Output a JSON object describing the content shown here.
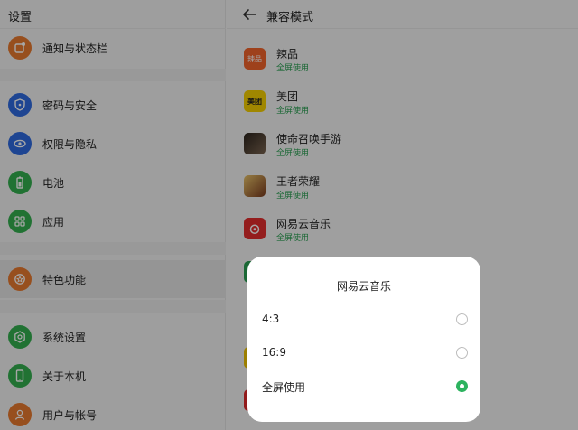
{
  "left": {
    "title": "设置",
    "items": [
      {
        "label": "通知与状态栏",
        "icon": "notification-icon",
        "color": "#e97a2e"
      },
      {
        "label": "密码与安全",
        "icon": "shield-icon",
        "color": "#2f6be0"
      },
      {
        "label": "权限与隐私",
        "icon": "eye-icon",
        "color": "#2f6be0"
      },
      {
        "label": "电池",
        "icon": "battery-icon",
        "color": "#33b04f"
      },
      {
        "label": "应用",
        "icon": "apps-grid-icon",
        "color": "#33b04f"
      },
      {
        "label": "特色功能",
        "icon": "star-icon",
        "color": "#e97a2e"
      },
      {
        "label": "系统设置",
        "icon": "system-settings-icon",
        "color": "#33b04f"
      },
      {
        "label": "关于本机",
        "icon": "phone-icon",
        "color": "#33b04f"
      },
      {
        "label": "用户与帐号",
        "icon": "user-icon",
        "color": "#e97a2e"
      }
    ]
  },
  "right": {
    "title": "兼容模式",
    "apps": [
      {
        "name": "辣品",
        "mode": "全屏使用",
        "icon_text": "辣品",
        "icon_color": "#f3642c"
      },
      {
        "name": "美团",
        "mode": "全屏使用",
        "icon_text": "美团",
        "icon_color": "#f6d000"
      },
      {
        "name": "使命召唤手游",
        "mode": "全屏使用",
        "icon_text": "",
        "icon_color": "#5a4b3c"
      },
      {
        "name": "王者荣耀",
        "mode": "全屏使用",
        "icon_text": "",
        "icon_color": "#b8883a"
      },
      {
        "name": "网易云音乐",
        "mode": "全屏使用",
        "icon_text": "",
        "icon_color": "#e32d2d"
      }
    ]
  },
  "dialog": {
    "title": "网易云音乐",
    "options": [
      {
        "label": "4:3",
        "selected": false
      },
      {
        "label": "16:9",
        "selected": false
      },
      {
        "label": "全屏使用",
        "selected": true
      }
    ]
  }
}
